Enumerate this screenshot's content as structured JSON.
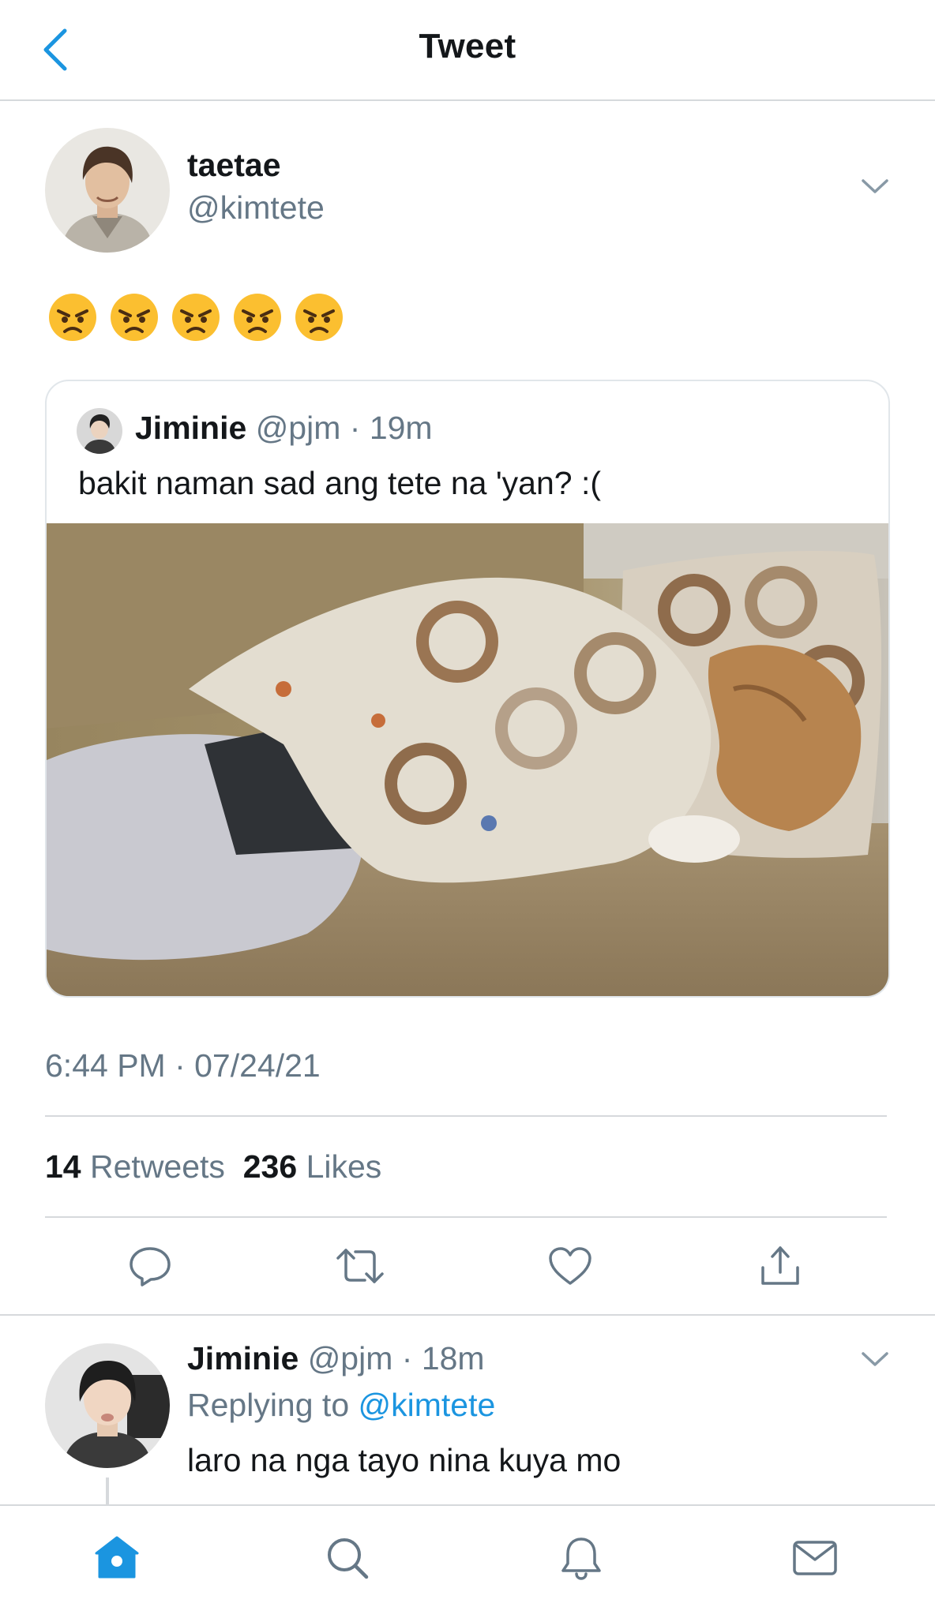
{
  "header": {
    "title": "Tweet",
    "back_icon": "chevron-left-icon"
  },
  "colors": {
    "accent": "#1b95e0",
    "secondary_text": "#657786",
    "divider": "#d6d9dc",
    "emoji_face": "#fbbf30"
  },
  "main_tweet": {
    "author_name": "taetae",
    "author_handle": "@kimtete",
    "emoji_count": 5,
    "emoji_icon": "angry-face-emoji",
    "timestamp": "6:44 PM · 07/24/21",
    "retweet_count": "14",
    "retweet_label": "Retweets",
    "like_count": "236",
    "like_label": "Likes"
  },
  "quoted_tweet": {
    "author_name": "Jiminie",
    "author_handle": "@pjm",
    "separator": " · ",
    "time": "19m",
    "text": "bakit naman sad ang tete na 'yan? :("
  },
  "actions": [
    "reply-icon",
    "retweet-icon",
    "like-icon",
    "share-icon"
  ],
  "reply": {
    "author_name": "Jiminie",
    "author_handle": "@pjm",
    "separator": " · ",
    "time": "18m",
    "replying_label": "Replying to ",
    "replying_handle": "@kimtete",
    "text": "laro na nga tayo nina kuya mo"
  },
  "tab_bar": [
    "home-icon",
    "search-icon",
    "notifications-icon",
    "messages-icon"
  ]
}
